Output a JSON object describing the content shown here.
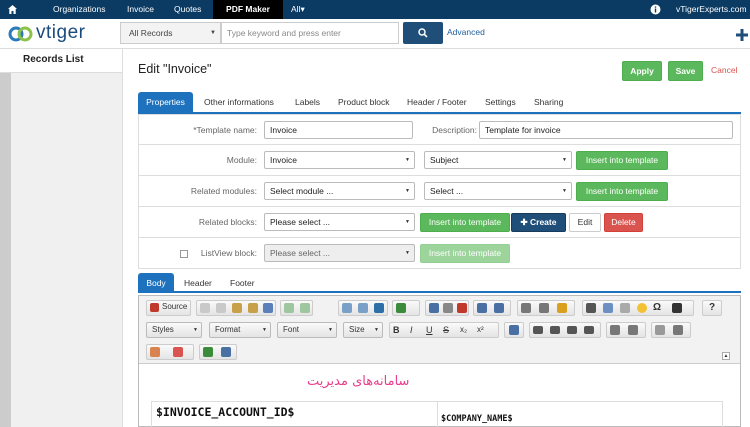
{
  "topnav": {
    "items": [
      "Organizations",
      "Invoice",
      "Quotes",
      "PDF Maker",
      "All"
    ],
    "brand_site": "vTigerExperts.com",
    "all_caret": "▾"
  },
  "header": {
    "logo_text": "vtiger",
    "records_select": "All Records",
    "search_placeholder": "Type keyword and press enter",
    "advanced": "Advanced"
  },
  "sidebar": {
    "title": "Records List"
  },
  "page": {
    "title": "Edit \"Invoice\"",
    "apply": "Apply",
    "save": "Save",
    "cancel": "Cancel"
  },
  "tabs": [
    "Properties",
    "Other informations",
    "Labels",
    "Product block",
    "Header / Footer",
    "Settings",
    "Sharing"
  ],
  "form": {
    "template_name_label": "*Template name:",
    "template_name_value": "Invoice",
    "description_label": "Description:",
    "description_value": "Template for invoice",
    "module_label": "Module:",
    "module_value": "Invoice",
    "module_field_value": "Subject",
    "insert": "Insert into template",
    "related_modules_label": "Related modules:",
    "related_modules_value": "Select module ...",
    "related_field_value": "Select ...",
    "related_blocks_label": "Related blocks:",
    "related_blocks_value": "Please select ...",
    "create": "Create",
    "edit": "Edit",
    "delete": "Delete",
    "listview_label": "ListView block:",
    "listview_value": "Please select ..."
  },
  "editor": {
    "subtabs": [
      "Body",
      "Header",
      "Footer"
    ],
    "source": "Source",
    "combos": [
      "Styles",
      "Format",
      "Font",
      "Size"
    ],
    "cell1": "$INVOICE_ACCOUNT_ID$",
    "cell2": "$COMPANY_NAME$",
    "watermark": "سامانه‌های مدیریت"
  },
  "colors": {
    "nav": "#0b3a63",
    "tab": "#1e72bd",
    "green": "#5cb85c",
    "primary": "#1f4e79",
    "red": "#d9534f",
    "cancel": "#d9534f"
  }
}
